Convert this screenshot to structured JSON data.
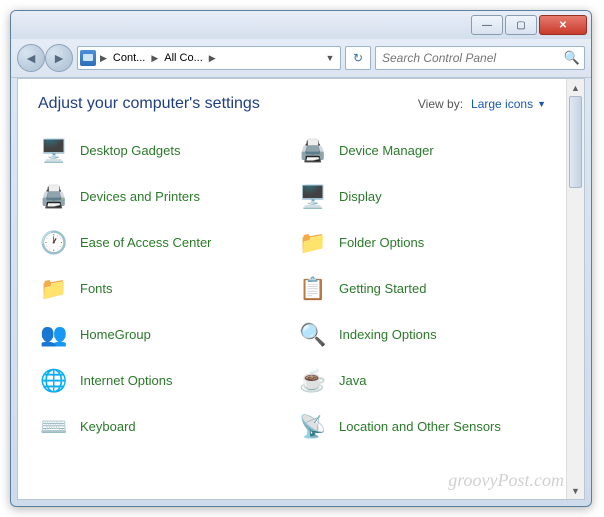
{
  "window": {
    "min": "—",
    "max": "▢",
    "close": "✕"
  },
  "nav": {
    "back": "◄",
    "forward": "►"
  },
  "breadcrumb": {
    "items": [
      "Cont...",
      "All Co..."
    ]
  },
  "search": {
    "placeholder": "Search Control Panel"
  },
  "heading": "Adjust your computer's settings",
  "viewby": {
    "label": "View by:",
    "value": "Large icons"
  },
  "items": [
    {
      "label": "Desktop Gadgets",
      "icon": "🖥️"
    },
    {
      "label": "Device Manager",
      "icon": "🖨️"
    },
    {
      "label": "Devices and Printers",
      "icon": "🖨️"
    },
    {
      "label": "Display",
      "icon": "🖥️"
    },
    {
      "label": "Ease of Access Center",
      "icon": "🕐"
    },
    {
      "label": "Folder Options",
      "icon": "📁"
    },
    {
      "label": "Fonts",
      "icon": "📁"
    },
    {
      "label": "Getting Started",
      "icon": "📋"
    },
    {
      "label": "HomeGroup",
      "icon": "👥"
    },
    {
      "label": "Indexing Options",
      "icon": "🔍"
    },
    {
      "label": "Internet Options",
      "icon": "🌐"
    },
    {
      "label": "Java",
      "icon": "☕"
    },
    {
      "label": "Keyboard",
      "icon": "⌨️"
    },
    {
      "label": "Location and Other Sensors",
      "icon": "📡"
    }
  ],
  "watermark": "groovyPost.com"
}
